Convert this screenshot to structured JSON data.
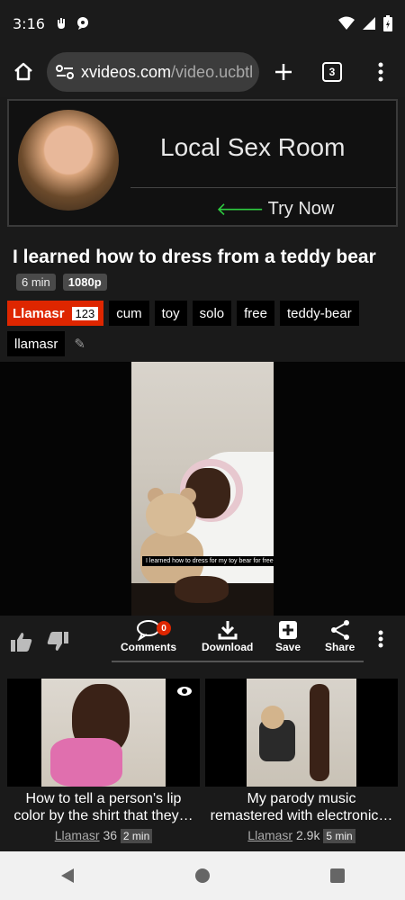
{
  "status": {
    "time": "3:16",
    "left_icons": [
      "hand-notification-icon",
      "chat-notification-icon"
    ],
    "right_icons": [
      "wifi-icon",
      "signal-icon",
      "battery-icon"
    ]
  },
  "browser": {
    "url_host": "xvideos.com",
    "url_path": "/video.ucbtl",
    "tab_count": "3"
  },
  "ad": {
    "title": "Local Sex Room",
    "cta": "Try Now"
  },
  "video": {
    "title": "I learned how to dress from a teddy bear",
    "duration": "6 min",
    "quality": "1080p",
    "uploader": "Llamasr",
    "uploader_count": "123",
    "tags": [
      "cum",
      "toy",
      "solo",
      "free",
      "teddy-bear"
    ],
    "extra_tag": "llamasr",
    "caption": "I learned how to dress for my toy bear for free"
  },
  "actions": {
    "comments_label": "Comments",
    "comments_count": "0",
    "download_label": "Download",
    "save_label": "Save",
    "share_label": "Share"
  },
  "related": [
    {
      "title_line1": "How to tell a person's lip",
      "title_line2": "color by the shirt that they…",
      "author": "Llamasr",
      "views": "36",
      "duration": "2 min"
    },
    {
      "title_line1": "My parody music",
      "title_line2": "remastered with electronic…",
      "author": "Llamasr",
      "views": "2.9k",
      "duration": "5 min"
    }
  ],
  "colors": {
    "accent_red": "#de2600",
    "background": "#1a1a1a",
    "nav_bar": "#f1f1f1"
  }
}
